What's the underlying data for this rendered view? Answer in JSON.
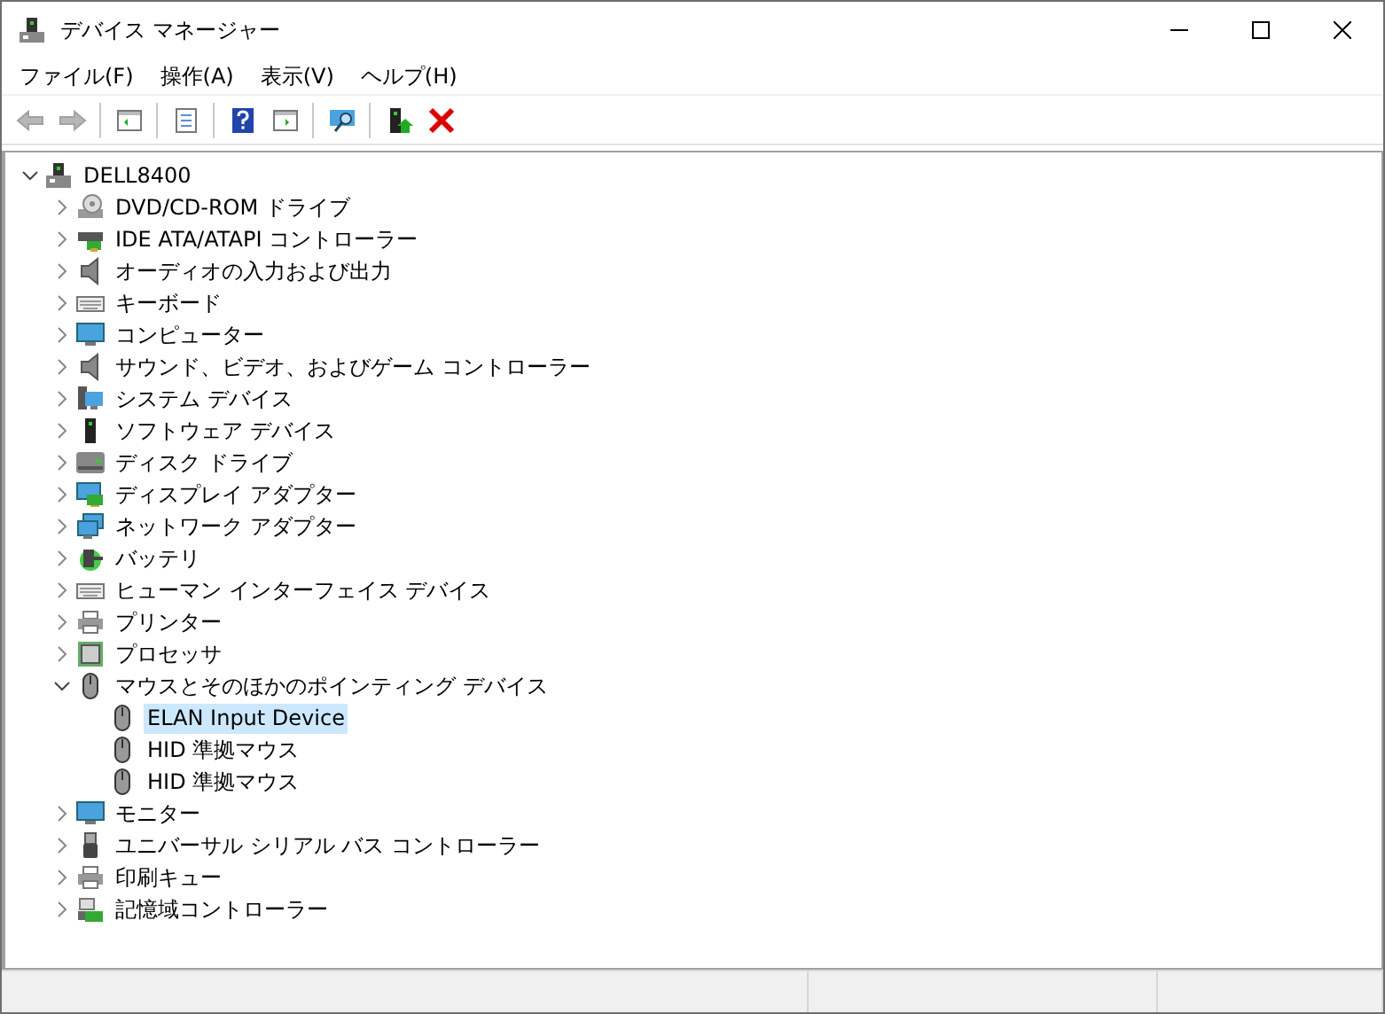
{
  "window": {
    "title": "デバイス マネージャー"
  },
  "menu": [
    "ファイル(F)",
    "操作(A)",
    "表示(V)",
    "ヘルプ(H)"
  ],
  "toolbar": [
    {
      "kind": "back",
      "disabled": true
    },
    {
      "kind": "forward",
      "disabled": true
    },
    {
      "kind": "sep"
    },
    {
      "kind": "tree",
      "disabled": false
    },
    {
      "kind": "sep"
    },
    {
      "kind": "properties",
      "disabled": false
    },
    {
      "kind": "sep"
    },
    {
      "kind": "help",
      "disabled": false
    },
    {
      "kind": "pane",
      "disabled": false
    },
    {
      "kind": "sep"
    },
    {
      "kind": "scan",
      "disabled": false
    },
    {
      "kind": "sep"
    },
    {
      "kind": "update",
      "disabled": false
    },
    {
      "kind": "remove",
      "disabled": false
    }
  ],
  "tree": {
    "label": "DELL8400",
    "kind": "computer",
    "expanded": true,
    "selected": false,
    "children": [
      {
        "label": "DVD/CD-ROM ドライブ",
        "kind": "optical",
        "expanded": false,
        "selected": false
      },
      {
        "label": "IDE ATA/ATAPI コントローラー",
        "kind": "controller",
        "expanded": false,
        "selected": false
      },
      {
        "label": "オーディオの入力および出力",
        "kind": "speaker",
        "expanded": false,
        "selected": false
      },
      {
        "label": "キーボード",
        "kind": "keyboard",
        "expanded": false,
        "selected": false
      },
      {
        "label": "コンピューター",
        "kind": "monitor",
        "expanded": false,
        "selected": false
      },
      {
        "label": "サウンド、ビデオ、およびゲーム コントローラー",
        "kind": "speaker",
        "expanded": false,
        "selected": false
      },
      {
        "label": "システム デバイス",
        "kind": "system",
        "expanded": false,
        "selected": false
      },
      {
        "label": "ソフトウェア デバイス",
        "kind": "software",
        "expanded": false,
        "selected": false
      },
      {
        "label": "ディスク ドライブ",
        "kind": "disk",
        "expanded": false,
        "selected": false
      },
      {
        "label": "ディスプレイ アダプター",
        "kind": "display",
        "expanded": false,
        "selected": false
      },
      {
        "label": "ネットワーク アダプター",
        "kind": "network",
        "expanded": false,
        "selected": false
      },
      {
        "label": "バッテリ",
        "kind": "battery",
        "expanded": false,
        "selected": false
      },
      {
        "label": "ヒューマン インターフェイス デバイス",
        "kind": "keyboard",
        "expanded": false,
        "selected": false
      },
      {
        "label": "プリンター",
        "kind": "printer",
        "expanded": false,
        "selected": false
      },
      {
        "label": "プロセッサ",
        "kind": "processor",
        "expanded": false,
        "selected": false
      },
      {
        "label": "マウスとそのほかのポインティング デバイス",
        "kind": "mouse",
        "expanded": true,
        "selected": false,
        "children": [
          {
            "label": "ELAN Input Device",
            "kind": "mouse",
            "selected": true
          },
          {
            "label": "HID 準拠マウス",
            "kind": "mouse",
            "selected": false
          },
          {
            "label": "HID 準拠マウス",
            "kind": "mouse",
            "selected": false
          }
        ]
      },
      {
        "label": "モニター",
        "kind": "monitor",
        "expanded": false,
        "selected": false
      },
      {
        "label": "ユニバーサル シリアル バス コントローラー",
        "kind": "usb",
        "expanded": false,
        "selected": false
      },
      {
        "label": "印刷キュー",
        "kind": "printer",
        "expanded": false,
        "selected": false
      },
      {
        "label": "記憶域コントローラー",
        "kind": "storage",
        "expanded": false,
        "selected": false
      }
    ]
  }
}
